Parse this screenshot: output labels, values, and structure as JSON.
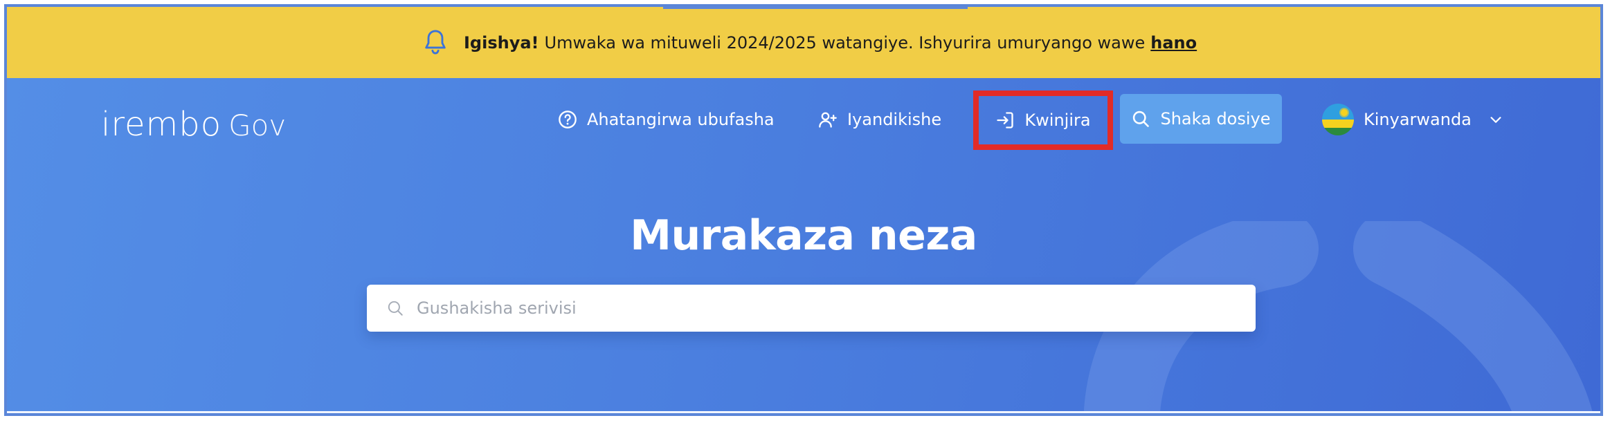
{
  "announcement": {
    "icon": "bell-icon",
    "bold_text": "Igishya!",
    "message": "Umwaka wa mituweli 2024/2025 watangiye. Ishyurira umuryango wawe",
    "link_text": "hano",
    "background_color": "#f1cd46"
  },
  "logo": {
    "brand": "irembo",
    "suffix": "Gov"
  },
  "nav": {
    "help": {
      "icon": "help-circle-icon",
      "label": "Ahatangirwa ubufasha"
    },
    "register": {
      "icon": "user-plus-icon",
      "label": "Iyandikishe"
    },
    "login": {
      "icon": "login-icon",
      "label": "Kwinjira",
      "highlight_color": "#e22b27"
    },
    "search_file": {
      "icon": "search-icon",
      "label": "Shaka dosiye",
      "background_color": "#5fa2ec"
    },
    "language": {
      "icon": "rwanda-flag-icon",
      "label": "Kinyarwanda",
      "dropdown_icon": "chevron-down-icon"
    }
  },
  "hero": {
    "title": "Murakaza neza",
    "search": {
      "icon": "search-icon",
      "placeholder": "Gushakisha serivisi",
      "value": ""
    }
  },
  "colors": {
    "hero_gradient_start": "#548ee6",
    "hero_gradient_end": "#3f6ad5",
    "text_on_hero": "#ffffff"
  }
}
